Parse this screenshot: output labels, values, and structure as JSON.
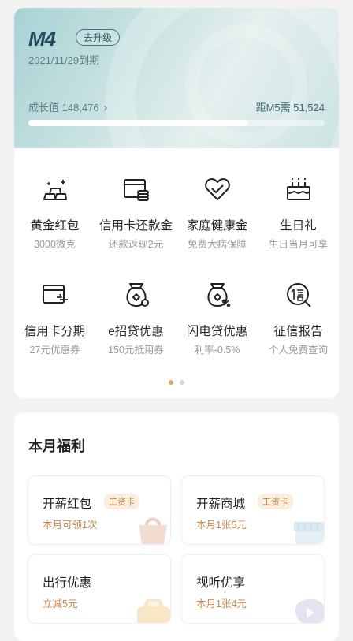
{
  "membership": {
    "level": "M4",
    "upgrade_label": "去升级",
    "expire": "2021/11/29到期",
    "growth_label": "成长值 148,476",
    "growth_chevron": "›",
    "next_label": "距M5需  51,524",
    "progress": 0.74
  },
  "features": [
    {
      "title": "黄金红包",
      "sub": "3000微克",
      "icon": "gold-bars-icon"
    },
    {
      "title": "信用卡还款金",
      "sub": "还款返现2元",
      "icon": "credit-card-coins-icon"
    },
    {
      "title": "家庭健康金",
      "sub": "免费大病保障",
      "icon": "heart-icon"
    },
    {
      "title": "生日礼",
      "sub": "生日当月可享",
      "icon": "birthday-cake-icon"
    },
    {
      "title": "信用卡分期",
      "sub": "27元优惠券",
      "icon": "credit-card-installment-icon"
    },
    {
      "title": "e招贷优惠",
      "sub": "150元抵用券",
      "icon": "money-bag-icon"
    },
    {
      "title": "闪电贷优惠",
      "sub": "利率-0.5%",
      "icon": "money-bag-percent-icon"
    },
    {
      "title": "征信报告",
      "sub": "个人免费查询",
      "icon": "credit-report-icon"
    }
  ],
  "pager": {
    "active": 0,
    "count": 2,
    "active_color": "#d9a86c",
    "inactive_color": "#d6d6d6"
  },
  "benefits": {
    "title": "本月福利",
    "items": [
      {
        "name": "开薪红包",
        "tag": "工资卡",
        "desc": "本月可领1次",
        "icon": "red-envelope-icon"
      },
      {
        "name": "开薪商城",
        "tag": "工资卡",
        "desc": "本月1张5元",
        "icon": "storefront-icon"
      },
      {
        "name": "出行优惠",
        "tag": "",
        "desc": "立减5元",
        "icon": "car-icon"
      },
      {
        "name": "视听优享",
        "tag": "",
        "desc": "本月1张4元",
        "icon": "play-icon"
      }
    ]
  },
  "colors": {
    "accent": "#c8894d",
    "tag_bg": "#fbeee0",
    "level_text": "#1f4a5e"
  }
}
